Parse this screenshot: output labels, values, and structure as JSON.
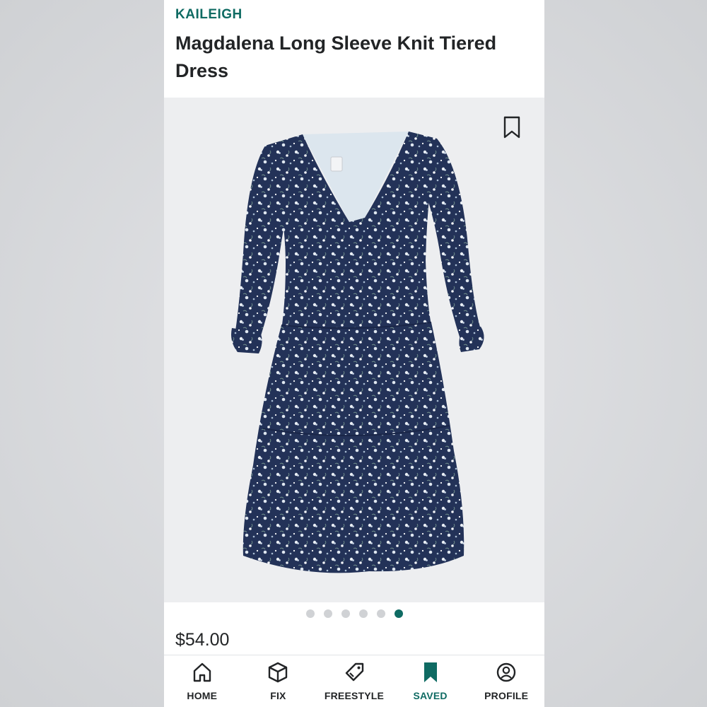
{
  "product": {
    "brand": "KAILEIGH",
    "title": "Magdalena Long Sleeve Knit Tiered Dress",
    "price": "$54.00",
    "image_subject": "navy-floral-dress",
    "bookmark_icon": "bookmark-outline-icon"
  },
  "carousel": {
    "total": 6,
    "active_index": 5
  },
  "tabbar": {
    "items": [
      {
        "label": "HOME",
        "icon": "home-icon",
        "active": false
      },
      {
        "label": "FIX",
        "icon": "box-icon",
        "active": false
      },
      {
        "label": "FREESTYLE",
        "icon": "tag-icon",
        "active": false
      },
      {
        "label": "SAVED",
        "icon": "bookmark-filled-icon",
        "active": true
      },
      {
        "label": "PROFILE",
        "icon": "profile-icon",
        "active": false
      }
    ]
  },
  "colors": {
    "accent": "#0f6b63",
    "text": "#222426",
    "image_bg": "#edeef0",
    "dress_navy": "#233258"
  }
}
